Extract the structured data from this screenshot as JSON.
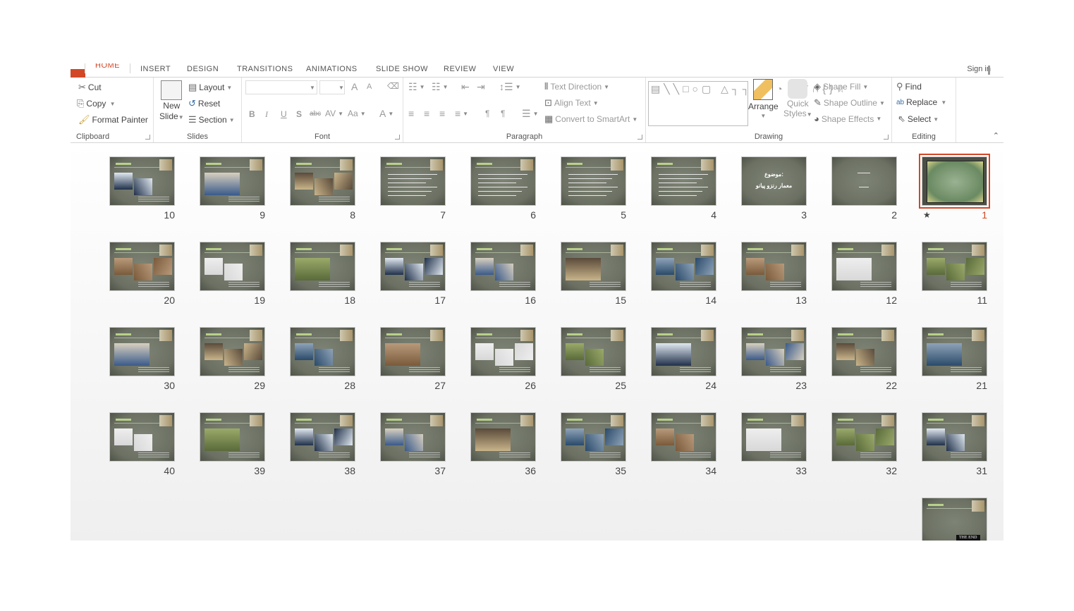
{
  "tabs": [
    "HOME",
    "INSERT",
    "DESIGN",
    "TRANSITIONS",
    "ANIMATIONS",
    "SLIDE SHOW",
    "REVIEW",
    "VIEW"
  ],
  "sign_in": "Sign in",
  "clipboard": {
    "label": "Clipboard",
    "cut": "Cut",
    "copy": "Copy",
    "format_painter": "Format Painter"
  },
  "slides_group": {
    "label": "Slides",
    "new_slide_1": "New",
    "new_slide_2": "Slide",
    "layout": "Layout",
    "reset": "Reset",
    "section": "Section"
  },
  "font": {
    "label": "Font",
    "bold": "B",
    "italic": "I",
    "underline": "U",
    "shadow": "S",
    "strike": "abc",
    "spacing": "AV",
    "case": "Aa",
    "color": "A",
    "grow": "A",
    "shrink": "A"
  },
  "paragraph": {
    "label": "Paragraph",
    "text_direction": "Text Direction",
    "align_text": "Align Text",
    "convert_smartart": "Convert to SmartArt"
  },
  "drawing": {
    "label": "Drawing",
    "arrange": "Arrange",
    "quick_1": "Quick",
    "quick_2": "Styles",
    "shape_fill": "Shape Fill",
    "shape_outline": "Shape Outline",
    "shape_effects": "Shape Effects"
  },
  "editing": {
    "label": "Editing",
    "find": "Find",
    "replace": "Replace",
    "select": "Select"
  },
  "accent": "#d24726",
  "selected_slide": 1,
  "slide3": {
    "line1": "موضوع:",
    "line2": "معمار رنزو پیانو"
  },
  "slide41": {
    "text": "THE END"
  },
  "slides": [
    "1",
    "2",
    "3",
    "4",
    "5",
    "6",
    "7",
    "8",
    "9",
    "10",
    "11",
    "12",
    "13",
    "14",
    "15",
    "16",
    "17",
    "18",
    "19",
    "20",
    "21",
    "22",
    "23",
    "24",
    "25",
    "26",
    "27",
    "28",
    "29",
    "30",
    "31",
    "32",
    "33",
    "34",
    "35",
    "36",
    "37",
    "38",
    "39",
    "40",
    ""
  ]
}
